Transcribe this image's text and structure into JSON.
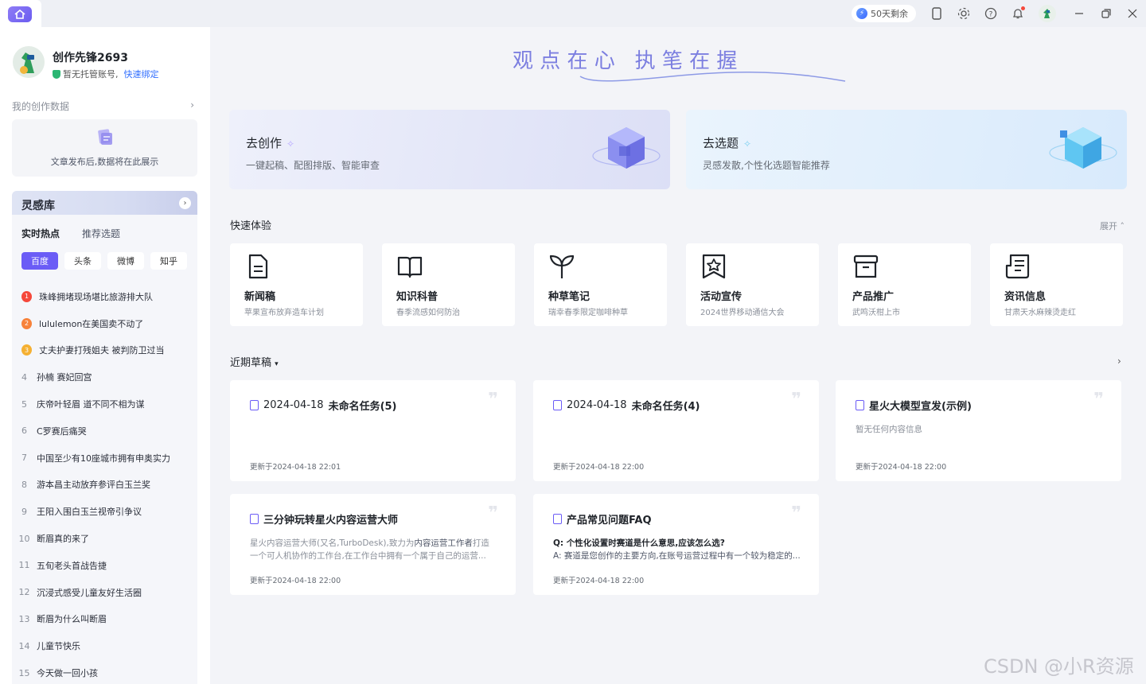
{
  "titlebar": {
    "quota_text": "50天剩余"
  },
  "user": {
    "name": "创作先锋2693",
    "status": "暂无托管账号,",
    "bind_link": "快速绑定"
  },
  "my_data": {
    "label": "我的创作数据",
    "empty_text": "文章发布后,数据将在此展示"
  },
  "library": {
    "title": "灵感库",
    "tabs": [
      "实时热点",
      "推荐选题"
    ],
    "chips": [
      "百度",
      "头条",
      "微博",
      "知乎"
    ],
    "hot_items": [
      {
        "rank": "1",
        "text": "珠峰拥堵现场堪比旅游排大队"
      },
      {
        "rank": "2",
        "text": "lululemon在美国卖不动了"
      },
      {
        "rank": "3",
        "text": "丈夫护妻打残姐夫 被判防卫过当"
      },
      {
        "rank": "4",
        "text": "孙楠 赛妃回宫"
      },
      {
        "rank": "5",
        "text": "庆帝叶轻眉 道不同不相为谋"
      },
      {
        "rank": "6",
        "text": "C罗赛后痛哭"
      },
      {
        "rank": "7",
        "text": "中国至少有10座城市拥有申奥实力"
      },
      {
        "rank": "8",
        "text": "游本昌主动放弃参评白玉兰奖"
      },
      {
        "rank": "9",
        "text": "王阳入围白玉兰视帝引争议"
      },
      {
        "rank": "10",
        "text": "断眉真的来了"
      },
      {
        "rank": "11",
        "text": "五旬老头首战告捷"
      },
      {
        "rank": "12",
        "text": "沉浸式感受儿童友好生活圈"
      },
      {
        "rank": "13",
        "text": "断眉为什么叫断眉"
      },
      {
        "rank": "14",
        "text": "儿童节快乐"
      },
      {
        "rank": "15",
        "text": "今天做一回小孩"
      }
    ]
  },
  "hero": {
    "slogan": "观 点 在 心   执 笔 在 握"
  },
  "big_cards": [
    {
      "title": "去创作",
      "subtitle": "一键起稿、配图排版、智能审查"
    },
    {
      "title": "去选题",
      "subtitle": "灵感发散,个性化选题智能推荐"
    }
  ],
  "quick": {
    "title": "快速体验",
    "expand_label": "展开",
    "cards": [
      {
        "title": "新闻稿",
        "subtitle": "苹果宣布放弃造车计划",
        "icon": "document-icon"
      },
      {
        "title": "知识科普",
        "subtitle": "春季流感如何防治",
        "icon": "book-icon"
      },
      {
        "title": "种草笔记",
        "subtitle": "瑞幸春季限定咖啡种草",
        "icon": "sprout-icon"
      },
      {
        "title": "活动宣传",
        "subtitle": "2024世界移动通信大会",
        "icon": "star-badge-icon"
      },
      {
        "title": "产品推广",
        "subtitle": "武鸣沃柑上市",
        "icon": "box-icon"
      },
      {
        "title": "资讯信息",
        "subtitle": "甘肃天水麻辣烫走红",
        "icon": "news-icon"
      }
    ]
  },
  "recent": {
    "title": "近期草稿",
    "drafts": [
      {
        "date": "2024-04-18",
        "title": "未命名任务(5)",
        "time": "更新于2024-04-18 22:01"
      },
      {
        "date": "2024-04-18",
        "title": "未命名任务(4)",
        "time": "更新于2024-04-18 22:00"
      },
      {
        "title": "星火大模型宣发(示例)",
        "body": "暂无任何内容信息",
        "time": "更新于2024-04-18 22:00"
      },
      {
        "title": "三分钟玩转星火内容运营大师",
        "body_a": "星火内容运营大师(又名,TurboDesk),致力为",
        "body_hl": "内容运营工作者",
        "body_b": "打造一个可人机协作的工作台,在工作台中拥有一个属于自己的运营",
        "time": "更新于2024-04-18 22:00"
      },
      {
        "title": "产品常见问题FAQ",
        "q": "Q: 个性化设置时赛道是什么意思,应该怎么选?",
        "a": "A: 赛道是您创作的主要方向,在账号运营过程中有一个较为稳定的...",
        "time": "更新于2024-04-18 22:00"
      }
    ]
  },
  "watermark": "CSDN @小R资源",
  "colors": {
    "accent": "#6b5cf6",
    "link": "#3370ff",
    "bg": "#f3f4f8"
  }
}
